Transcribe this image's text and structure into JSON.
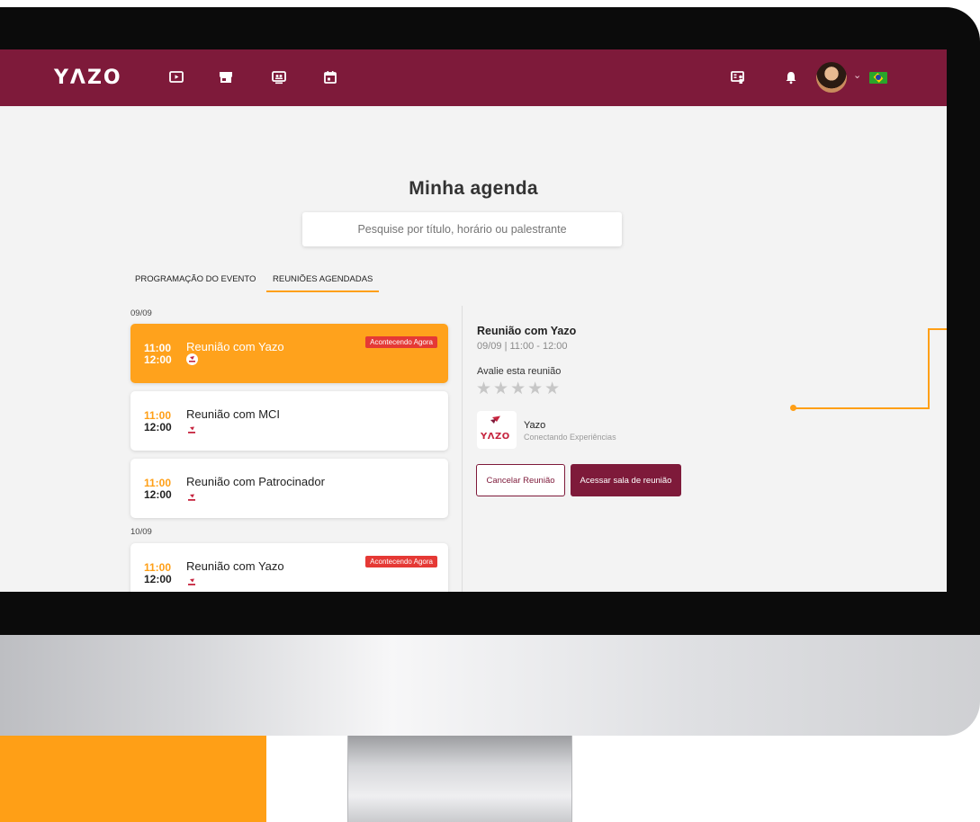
{
  "app": {
    "logo": "YΛZO"
  },
  "topbar": {
    "nav_icons": [
      "play-screen-icon",
      "store-icon",
      "presentation-icon",
      "calendar-icon"
    ],
    "right_icons": [
      "exhibitor-icon",
      "bell-icon"
    ],
    "language_flag": "brazil-flag-icon"
  },
  "page": {
    "title": "Minha agenda",
    "search_placeholder": "Pesquise por título, horário ou palestrante",
    "tabs": [
      "PROGRAMAÇÃO DO EVENTO",
      "REUNIÕES AGENDADAS"
    ],
    "active_tab_index": 1
  },
  "meetings": {
    "groups": [
      {
        "date": "09/09",
        "items": [
          {
            "start": "11:00",
            "end": "12:00",
            "title": "Reunião com Yazo",
            "badge": "Acontecendo Agora",
            "active": true
          },
          {
            "start": "11:00",
            "end": "12:00",
            "title": "Reunião com MCI",
            "badge": "",
            "active": false
          },
          {
            "start": "11:00",
            "end": "12:00",
            "title": "Reunião com Patrocinador",
            "badge": "",
            "active": false
          }
        ]
      },
      {
        "date": "10/09",
        "items": [
          {
            "start": "11:00",
            "end": "12:00",
            "title": "Reunião com Yazo",
            "badge": "Acontecendo Agora",
            "active": false
          }
        ]
      }
    ]
  },
  "detail": {
    "title": "Reunião com Yazo",
    "datetime": "09/09 | 11:00 - 12:00",
    "rate_label": "Avalie esta reunião",
    "stars": "★★★★★",
    "rating_value": 0,
    "org_name": "Yazo",
    "org_tagline": "Conectando Experiências",
    "org_logo_text": "YΛZO",
    "cancel_label": "Cancelar Reunião",
    "enter_label": "Acessar sala de reunião"
  },
  "colors": {
    "brand": "#7e1a3a",
    "accent": "#ff9f16",
    "badge": "#e53935",
    "background": "#f3f3f3"
  }
}
